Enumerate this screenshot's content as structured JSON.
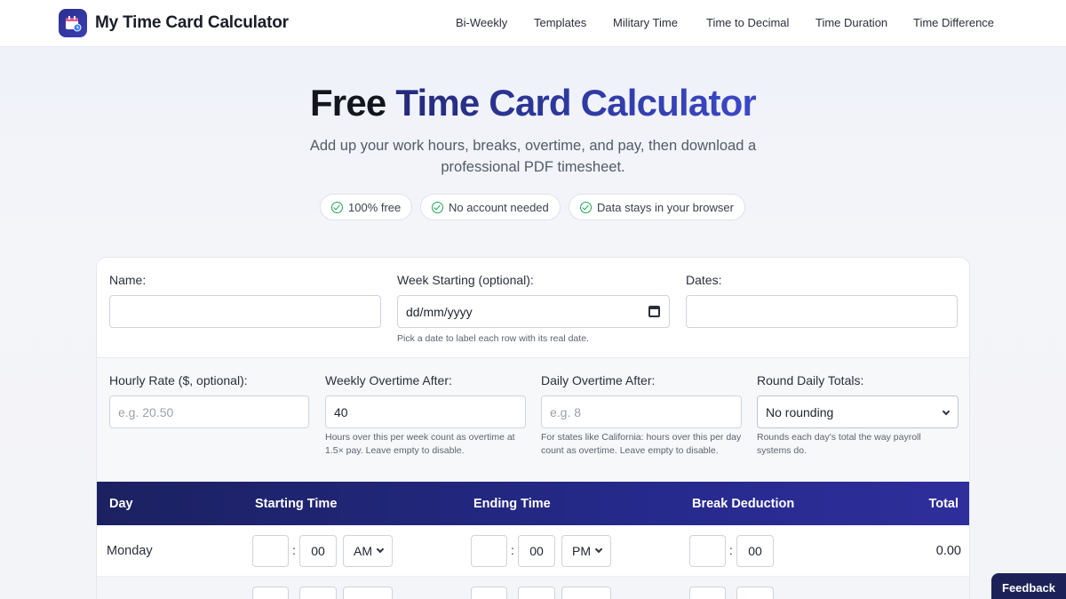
{
  "header": {
    "brand": "My Time Card Calculator",
    "nav": [
      "Bi-Weekly",
      "Templates",
      "Military Time",
      "Time to Decimal",
      "Time Duration",
      "Time Difference"
    ]
  },
  "hero": {
    "title_plain": "Free",
    "title_accent": "Time Card Calculator",
    "subtitle": "Add up your work hours, breaks, overtime, and pay, then download a professional PDF timesheet.",
    "pills": [
      "100% free",
      "No account needed",
      "Data stays in your browser"
    ]
  },
  "form": {
    "name_label": "Name:",
    "name_value": "",
    "week_label": "Week Starting (optional):",
    "week_placeholder": "dd/mm/yyyy",
    "week_hint": "Pick a date to label each row with its real date.",
    "dates_label": "Dates:",
    "dates_value": "",
    "rate_label": "Hourly Rate ($, optional):",
    "rate_placeholder": "e.g. 20.50",
    "weekly_ot_label": "Weekly Overtime After:",
    "weekly_ot_value": "40",
    "weekly_ot_hint": "Hours over this per week count as overtime at 1.5× pay. Leave empty to disable.",
    "daily_ot_label": "Daily Overtime After:",
    "daily_ot_placeholder": "e.g. 8",
    "daily_ot_hint": "For states like California: hours over this per day count as overtime. Leave empty to disable.",
    "round_label": "Round Daily Totals:",
    "round_value": "No rounding",
    "round_hint": "Rounds each day's total the way payroll systems do."
  },
  "table": {
    "headers": [
      "Day",
      "Starting Time",
      "Ending Time",
      "Break Deduction",
      "Total"
    ],
    "rows": [
      {
        "day": "Monday",
        "start_hour": "",
        "start_min": "00",
        "start_ampm": "AM",
        "end_hour": "",
        "end_min": "00",
        "end_ampm": "PM",
        "break_hour": "",
        "break_min": "00",
        "total": "0.00"
      },
      {
        "day": "",
        "start_hour": "",
        "start_min": "",
        "start_ampm": "",
        "end_hour": "",
        "end_min": "",
        "end_ampm": "",
        "break_hour": "",
        "break_min": "",
        "total": ""
      }
    ],
    "colon": ":"
  },
  "feedback_label": "Feedback",
  "colors": {
    "accent": "#25298a",
    "success": "#21a354",
    "brand_dark": "#1c2157"
  },
  "icons": {
    "logo": "calendar-clock-icon",
    "check": "check-circle-icon",
    "calendar": "calendar-icon",
    "dropdown": "chevron-down-icon"
  }
}
